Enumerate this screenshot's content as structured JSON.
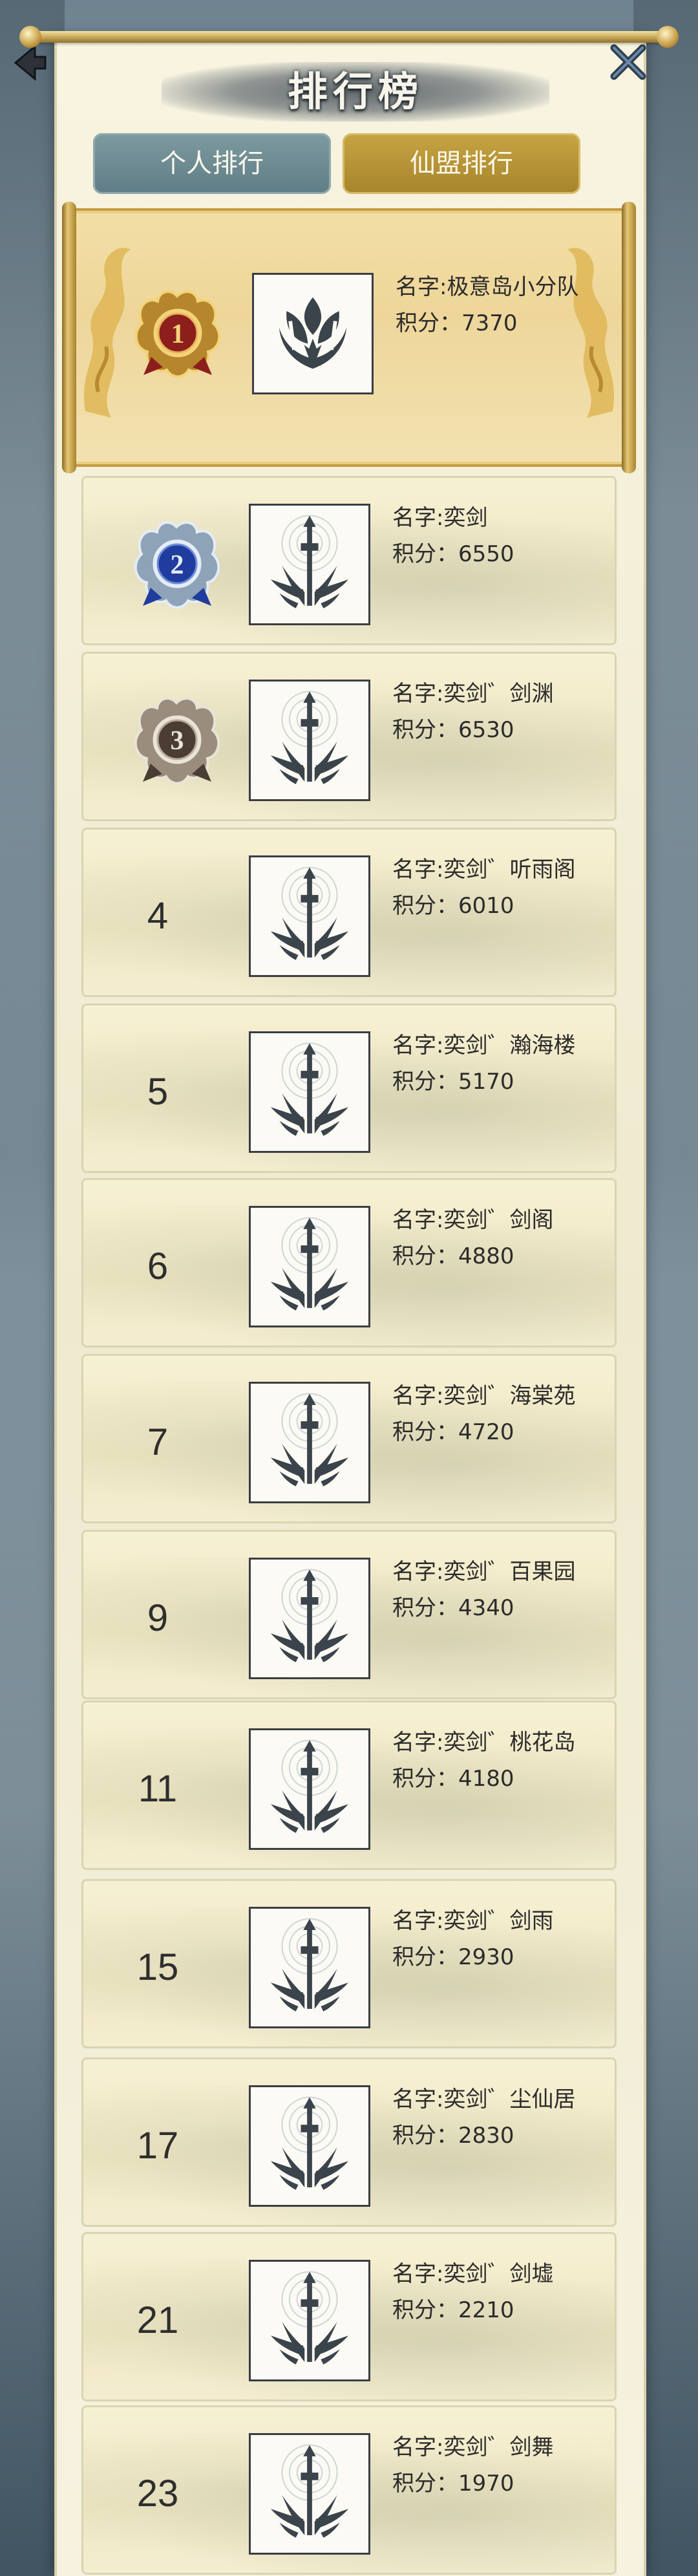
{
  "header": {
    "title": "排行榜"
  },
  "tabs": [
    {
      "label": "个人排行",
      "active": false
    },
    {
      "label": "仙盟排行",
      "active": true
    }
  ],
  "name_prefix": "名字:",
  "score_prefix": "积分：",
  "rankings": [
    {
      "rank": "1",
      "name": "极意岛小分队",
      "score": "7370",
      "emblem": "lotus-crest",
      "medal": "gold"
    },
    {
      "rank": "2",
      "name": "奕剑",
      "score": "6550",
      "emblem": "sword-crest",
      "medal": "silver-blue"
    },
    {
      "rank": "3",
      "name": "奕剑゛剑渊",
      "score": "6530",
      "emblem": "sword-crest",
      "medal": "bronze"
    },
    {
      "rank": "4",
      "name": "奕剑゛听雨阁",
      "score": "6010",
      "emblem": "sword-crest"
    },
    {
      "rank": "5",
      "name": "奕剑゛瀚海楼",
      "score": "5170",
      "emblem": "sword-crest"
    },
    {
      "rank": "6",
      "name": "奕剑゛剑阁",
      "score": "4880",
      "emblem": "sword-crest"
    },
    {
      "rank": "7",
      "name": "奕剑゛海棠苑",
      "score": "4720",
      "emblem": "sword-crest"
    },
    {
      "rank": "9",
      "name": "奕剑゛百果园",
      "score": "4340",
      "emblem": "sword-crest"
    },
    {
      "rank": "11",
      "name": "奕剑゛桃花岛",
      "score": "4180",
      "emblem": "sword-crest"
    },
    {
      "rank": "15",
      "name": "奕剑゛剑雨",
      "score": "2930",
      "emblem": "sword-crest"
    },
    {
      "rank": "17",
      "name": "奕剑゛尘仙居",
      "score": "2830",
      "emblem": "sword-crest"
    },
    {
      "rank": "21",
      "name": "奕剑゛剑墟",
      "score": "2210",
      "emblem": "sword-crest"
    },
    {
      "rank": "23",
      "name": "奕剑゛剑舞",
      "score": "1970",
      "emblem": "sword-crest"
    }
  ],
  "colors": {
    "gold": "#c7a443",
    "slate": "#5f7d86",
    "ink": "#2b2b2b"
  }
}
